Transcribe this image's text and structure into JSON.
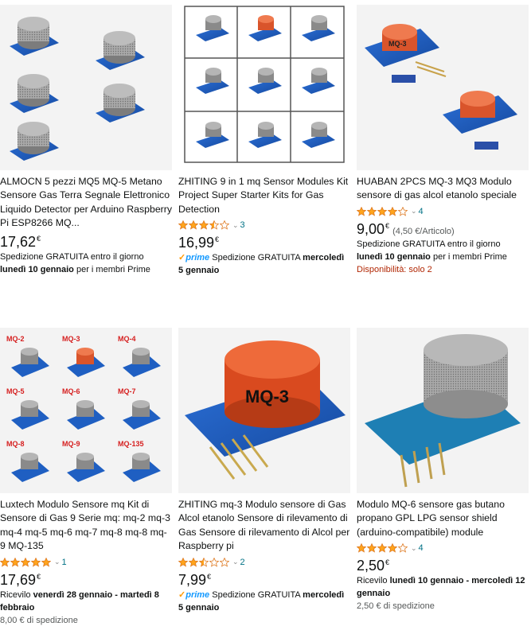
{
  "products": [
    {
      "title": "ALMOCN 5 pezzi MQ5 MQ-5 Metano Sensore Gas Terra Segnale Elettronico Liquido Detector per Arduino Raspberry Pi ESP8266 MQ...",
      "price": "17,62",
      "currency": "€",
      "shipping_1": "Spedizione GRATUITA entro il giorno",
      "shipping_2_bold": "lunedì 10 gennaio",
      "shipping_2_rest": " per i membri Prime"
    },
    {
      "title": "ZHITING 9 in 1 mq Sensor Modules Kit Project Super Starter Kits for Gas Detection",
      "rating": 3.5,
      "reviews": "3",
      "price": "16,99",
      "currency": "€",
      "prime_label": "prime",
      "shipping_text": " Spedizione GRATUITA ",
      "shipping_bold_1": "mercoledì",
      "shipping_bold_2": "5 gennaio"
    },
    {
      "title": "HUABAN 2PCS MQ-3 MQ3 Modulo sensore di gas alcol etanolo speciale",
      "rating": 4,
      "reviews": "4",
      "price": "9,00",
      "currency": "€",
      "unit_price": "(4,50 €/Articolo)",
      "shipping_1": "Spedizione GRATUITA entro il giorno",
      "shipping_2_bold": "lunedì 10 gennaio",
      "shipping_2_rest": " per i membri Prime",
      "availability": "Disponibilità: solo 2"
    },
    {
      "title": "Luxtech Modulo Sensore mq Kit di Sensore di Gas 9 Serie mq: mq-2 mq-3 mq-4 mq-5 mq-6 mq-7 mq-8 mq-8 mq-9 MQ-135",
      "rating": 5,
      "reviews": "1",
      "price": "17,69",
      "currency": "€",
      "delivery_prefix": "Ricevilo ",
      "delivery_bold": "venerdì 28 gennaio - martedì 8 febbraio",
      "shipping_cost": "8,00 € di spedizione",
      "image_labels": [
        "MQ-2",
        "MQ-3",
        "MQ-4",
        "MQ-5",
        "MQ-6",
        "MQ-7",
        "MQ-8",
        "MQ-9",
        "MQ-135"
      ]
    },
    {
      "title": "ZHITING mq-3 Modulo sensore di Gas Alcol etanolo Sensore di rilevamento di Gas Sensore di rilevamento di Alcol per Raspberry pi",
      "rating": 2.5,
      "reviews": "2",
      "price": "7,99",
      "currency": "€",
      "prime_label": "prime",
      "shipping_text": " Spedizione GRATUITA ",
      "shipping_bold_1": "mercoledì",
      "shipping_bold_2": "5 gennaio",
      "image_label": "MQ-3"
    },
    {
      "title": "Modulo MQ-6 sensore gas butano propano GPL LPG sensor shield (arduino-compatibile) module",
      "rating": 4,
      "reviews": "4",
      "price": "2,50",
      "currency": "€",
      "delivery_prefix": "Ricevilo ",
      "delivery_bold": "lunedì 10 gennaio - mercoledì 12 gennaio",
      "shipping_cost": "2,50 € di spedizione"
    }
  ],
  "colors": {
    "star": "#ffa41c",
    "link": "#007185",
    "prime": "#1399ff",
    "red": "#b12704",
    "pcb": "#1f5fc2",
    "mesh": "#9a9a9a",
    "orange": "#e8602a"
  }
}
